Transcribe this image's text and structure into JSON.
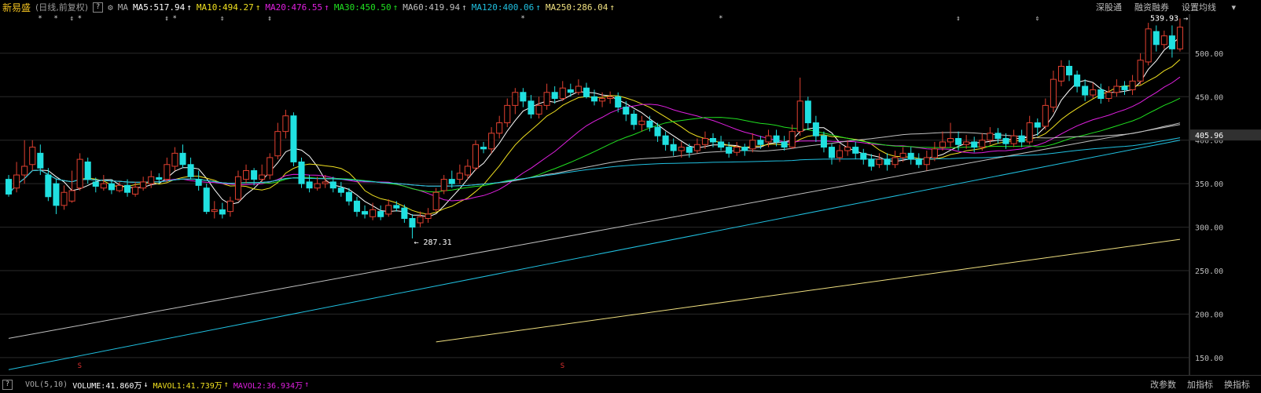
{
  "header": {
    "title": "新易盛",
    "subtitle": "(日线,前复权)",
    "help": "?",
    "ma_label": "MA",
    "indicators": [
      {
        "label": "MA5:517.94",
        "color": "#ffffff",
        "arrow": "↑"
      },
      {
        "label": "MA10:494.27",
        "color": "#f0e020",
        "arrow": "↑"
      },
      {
        "label": "MA20:476.55",
        "color": "#e020e0",
        "arrow": "↑"
      },
      {
        "label": "MA30:450.50",
        "color": "#20e020",
        "arrow": "↑"
      },
      {
        "label": "MA60:419.94",
        "color": "#c0c0c0",
        "arrow": "↑"
      },
      {
        "label": "MA120:400.06",
        "color": "#20c0e0",
        "arrow": "↑"
      },
      {
        "label": "MA250:286.04",
        "color": "#f0e080",
        "arrow": "↑"
      }
    ],
    "links": [
      "深股通",
      "融资融券",
      "设置均线"
    ]
  },
  "price_axis": {
    "ticks": [
      "500.00",
      "450.00",
      "400.00",
      "350.00",
      "300.00",
      "250.00",
      "200.00",
      "150.00"
    ],
    "last_price": "405.96"
  },
  "annotations": {
    "high": "539.93",
    "low": "287.31",
    "event_markers": [
      "*",
      "*",
      "⇕",
      "*",
      "⇕",
      "*",
      "⇕",
      "⇕",
      "*",
      "*",
      "⇕",
      "⇕"
    ],
    "s_markers": [
      "S",
      "S"
    ]
  },
  "footer": {
    "vol_label": "VOL(5,10)",
    "volume": "VOLUME:41.860万",
    "volume_arrow": "↓",
    "mavol1": "MAVOL1:41.739万",
    "mavol1_arrow": "↑",
    "mavol2": "MAVOL2:36.934万",
    "mavol2_arrow": "↑",
    "links": [
      "改参数",
      "加指标",
      "换指标"
    ]
  },
  "colors": {
    "up": "#e04030",
    "down": "#20e0e0",
    "ma5": "#ffffff",
    "ma10": "#f0e020",
    "ma20": "#e020e0",
    "ma30": "#20e020",
    "ma60": "#c0c0c0",
    "ma120": "#20c0e0",
    "ma250": "#f0e080"
  },
  "chart_data": {
    "type": "candlestick",
    "price_range": [
      130,
      545
    ],
    "candles": [
      [
        355,
        338,
        360,
        335
      ],
      [
        345,
        360,
        375,
        340
      ],
      [
        360,
        370,
        400,
        350
      ],
      [
        372,
        392,
        400,
        365
      ],
      [
        385,
        368,
        395,
        360
      ],
      [
        360,
        335,
        368,
        330
      ],
      [
        350,
        325,
        355,
        315
      ],
      [
        325,
        340,
        348,
        320
      ],
      [
        330,
        342,
        365,
        328
      ],
      [
        345,
        378,
        385,
        342
      ],
      [
        375,
        355,
        380,
        350
      ],
      [
        352,
        347,
        357,
        340
      ],
      [
        345,
        350,
        360,
        342
      ],
      [
        350,
        343,
        355,
        338
      ],
      [
        342,
        348,
        352,
        340
      ],
      [
        348,
        340,
        355,
        335
      ],
      [
        338,
        346,
        352,
        335
      ],
      [
        345,
        352,
        358,
        342
      ],
      [
        350,
        358,
        365,
        345
      ],
      [
        357,
        355,
        362,
        350
      ],
      [
        355,
        372,
        380,
        352
      ],
      [
        370,
        385,
        392,
        365
      ],
      [
        385,
        372,
        395,
        368
      ],
      [
        372,
        358,
        380,
        355
      ],
      [
        355,
        348,
        365,
        342
      ],
      [
        345,
        318,
        350,
        315
      ],
      [
        318,
        320,
        330,
        310
      ],
      [
        320,
        315,
        328,
        310
      ],
      [
        318,
        330,
        335,
        312
      ],
      [
        332,
        358,
        365,
        330
      ],
      [
        355,
        365,
        372,
        350
      ],
      [
        365,
        355,
        368,
        348
      ],
      [
        355,
        360,
        372,
        352
      ],
      [
        360,
        380,
        385,
        355
      ],
      [
        382,
        410,
        420,
        378
      ],
      [
        410,
        428,
        435,
        402
      ],
      [
        428,
        375,
        432,
        370
      ],
      [
        375,
        350,
        380,
        345
      ],
      [
        352,
        345,
        360,
        340
      ],
      [
        345,
        350,
        358,
        342
      ],
      [
        350,
        352,
        360,
        345
      ],
      [
        352,
        345,
        358,
        340
      ],
      [
        345,
        340,
        352,
        335
      ],
      [
        340,
        330,
        345,
        325
      ],
      [
        330,
        318,
        335,
        312
      ],
      [
        318,
        315,
        325,
        310
      ],
      [
        312,
        320,
        328,
        308
      ],
      [
        318,
        312,
        325,
        308
      ],
      [
        315,
        325,
        332,
        312
      ],
      [
        325,
        322,
        330,
        318
      ],
      [
        322,
        310,
        326,
        305
      ],
      [
        310,
        300,
        315,
        287
      ],
      [
        305,
        312,
        318,
        300
      ],
      [
        310,
        315,
        322,
        305
      ],
      [
        320,
        340,
        345,
        318
      ],
      [
        342,
        355,
        360,
        338
      ],
      [
        355,
        350,
        365,
        345
      ],
      [
        355,
        362,
        372,
        350
      ],
      [
        360,
        370,
        378,
        355
      ],
      [
        368,
        395,
        400,
        365
      ],
      [
        392,
        390,
        398,
        385
      ],
      [
        390,
        408,
        415,
        385
      ],
      [
        408,
        420,
        428,
        402
      ],
      [
        420,
        440,
        448,
        415
      ],
      [
        440,
        455,
        460,
        430
      ],
      [
        455,
        445,
        460,
        438
      ],
      [
        445,
        430,
        452,
        425
      ],
      [
        430,
        440,
        450,
        425
      ],
      [
        440,
        455,
        465,
        435
      ],
      [
        455,
        448,
        462,
        442
      ],
      [
        448,
        460,
        468,
        445
      ],
      [
        458,
        455,
        465,
        450
      ],
      [
        455,
        462,
        470,
        452
      ],
      [
        460,
        450,
        466,
        448
      ],
      [
        450,
        445,
        458,
        440
      ],
      [
        445,
        448,
        455,
        438
      ],
      [
        448,
        450,
        456,
        442
      ],
      [
        450,
        438,
        455,
        432
      ],
      [
        438,
        430,
        445,
        422
      ],
      [
        430,
        418,
        435,
        412
      ],
      [
        418,
        422,
        428,
        410
      ],
      [
        422,
        415,
        428,
        410
      ],
      [
        415,
        405,
        420,
        398
      ],
      [
        405,
        395,
        410,
        388
      ],
      [
        395,
        388,
        402,
        382
      ],
      [
        388,
        392,
        398,
        380
      ],
      [
        392,
        386,
        396,
        380
      ],
      [
        388,
        395,
        402,
        385
      ],
      [
        395,
        402,
        410,
        390
      ],
      [
        402,
        398,
        408,
        392
      ],
      [
        398,
        392,
        405,
        388
      ],
      [
        392,
        385,
        398,
        380
      ],
      [
        386,
        392,
        398,
        382
      ],
      [
        392,
        388,
        396,
        382
      ],
      [
        390,
        400,
        408,
        386
      ],
      [
        400,
        395,
        405,
        390
      ],
      [
        398,
        405,
        412,
        392
      ],
      [
        405,
        398,
        412,
        393
      ],
      [
        398,
        392,
        405,
        388
      ],
      [
        392,
        410,
        418,
        390
      ],
      [
        410,
        445,
        472,
        405
      ],
      [
        445,
        420,
        450,
        412
      ],
      [
        420,
        405,
        428,
        398
      ],
      [
        405,
        392,
        410,
        386
      ],
      [
        392,
        380,
        396,
        372
      ],
      [
        380,
        388,
        395,
        375
      ],
      [
        388,
        392,
        400,
        382
      ],
      [
        392,
        385,
        398,
        378
      ],
      [
        385,
        378,
        390,
        372
      ],
      [
        378,
        370,
        384,
        365
      ],
      [
        372,
        378,
        385,
        368
      ],
      [
        378,
        372,
        385,
        365
      ],
      [
        372,
        380,
        388,
        368
      ],
      [
        380,
        385,
        392,
        375
      ],
      [
        385,
        378,
        392,
        372
      ],
      [
        378,
        372,
        385,
        368
      ],
      [
        372,
        380,
        388,
        365
      ],
      [
        380,
        390,
        398,
        376
      ],
      [
        392,
        398,
        410,
        388
      ],
      [
        398,
        402,
        420,
        392
      ],
      [
        402,
        395,
        410,
        388
      ],
      [
        395,
        398,
        406,
        390
      ],
      [
        398,
        392,
        404,
        386
      ],
      [
        392,
        400,
        408,
        388
      ],
      [
        400,
        408,
        415,
        395
      ],
      [
        408,
        402,
        414,
        396
      ],
      [
        402,
        396,
        408,
        390
      ],
      [
        396,
        405,
        412,
        392
      ],
      [
        405,
        398,
        412,
        392
      ],
      [
        398,
        420,
        428,
        395
      ],
      [
        420,
        415,
        425,
        405
      ],
      [
        416,
        440,
        448,
        412
      ],
      [
        438,
        470,
        480,
        432
      ],
      [
        468,
        485,
        492,
        462
      ],
      [
        485,
        475,
        492,
        468
      ],
      [
        475,
        462,
        480,
        455
      ],
      [
        462,
        452,
        470,
        445
      ],
      [
        452,
        458,
        466,
        448
      ],
      [
        458,
        448,
        465,
        442
      ],
      [
        448,
        455,
        462,
        444
      ],
      [
        455,
        462,
        470,
        450
      ],
      [
        462,
        458,
        468,
        452
      ],
      [
        458,
        468,
        475,
        452
      ],
      [
        468,
        492,
        500,
        464
      ],
      [
        490,
        528,
        535,
        486
      ],
      [
        525,
        510,
        532,
        502
      ],
      [
        510,
        520,
        526,
        505
      ],
      [
        520,
        505,
        532,
        495
      ],
      [
        505,
        530,
        540,
        502
      ]
    ]
  }
}
